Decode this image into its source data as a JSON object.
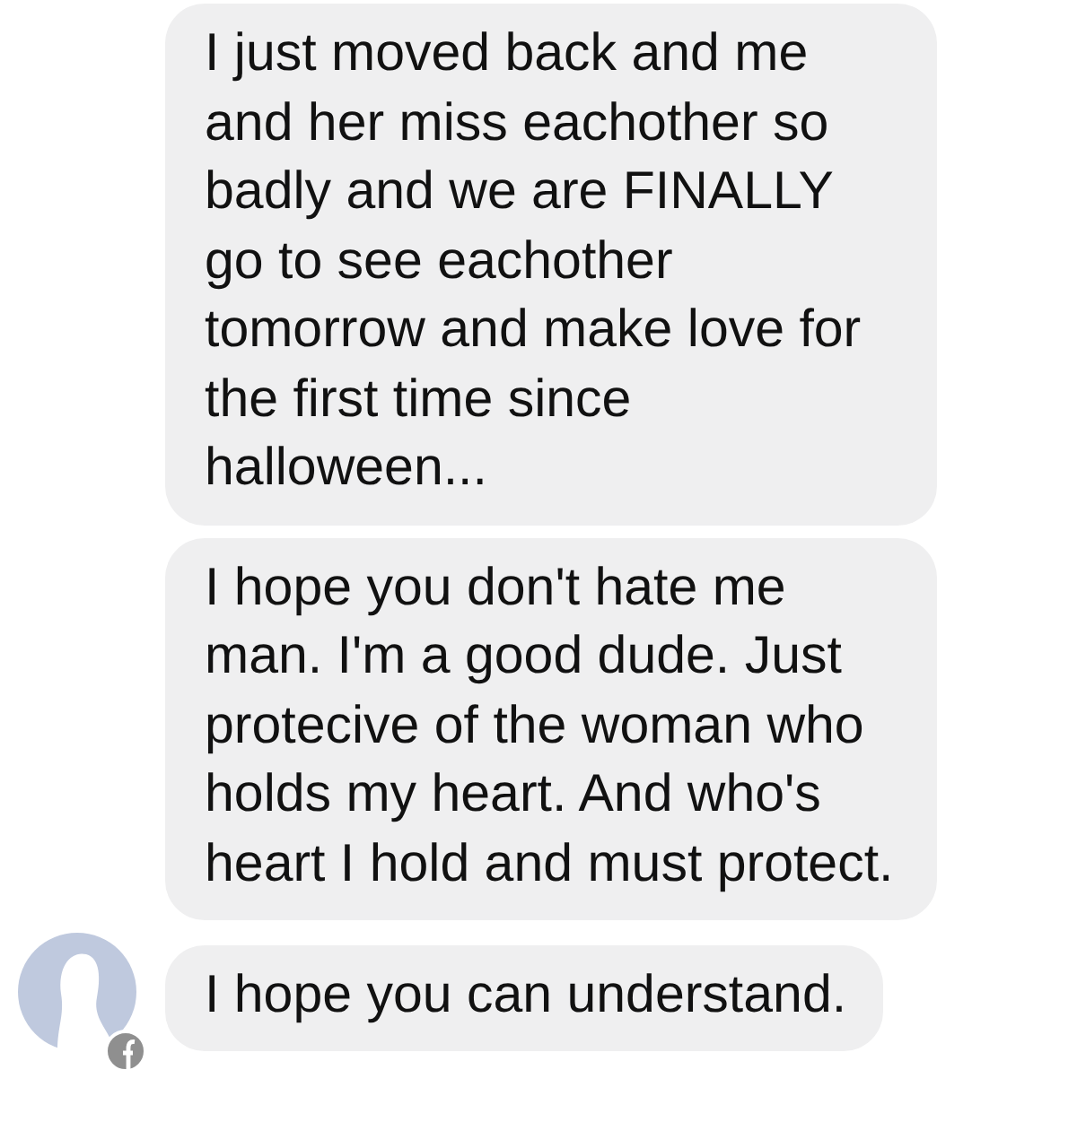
{
  "messages": [
    {
      "text": "I just moved back and me and her miss eachother so badly and we are FINALLY go to see eachother tomorrow and make love for the first time since halloween..."
    },
    {
      "text": "I hope you don't hate me man. I'm a good dude. Just protecive of the woman who holds my heart. And who's heart I hold and must protect."
    },
    {
      "text": "I hope you can understand.",
      "show_avatar": true
    }
  ]
}
